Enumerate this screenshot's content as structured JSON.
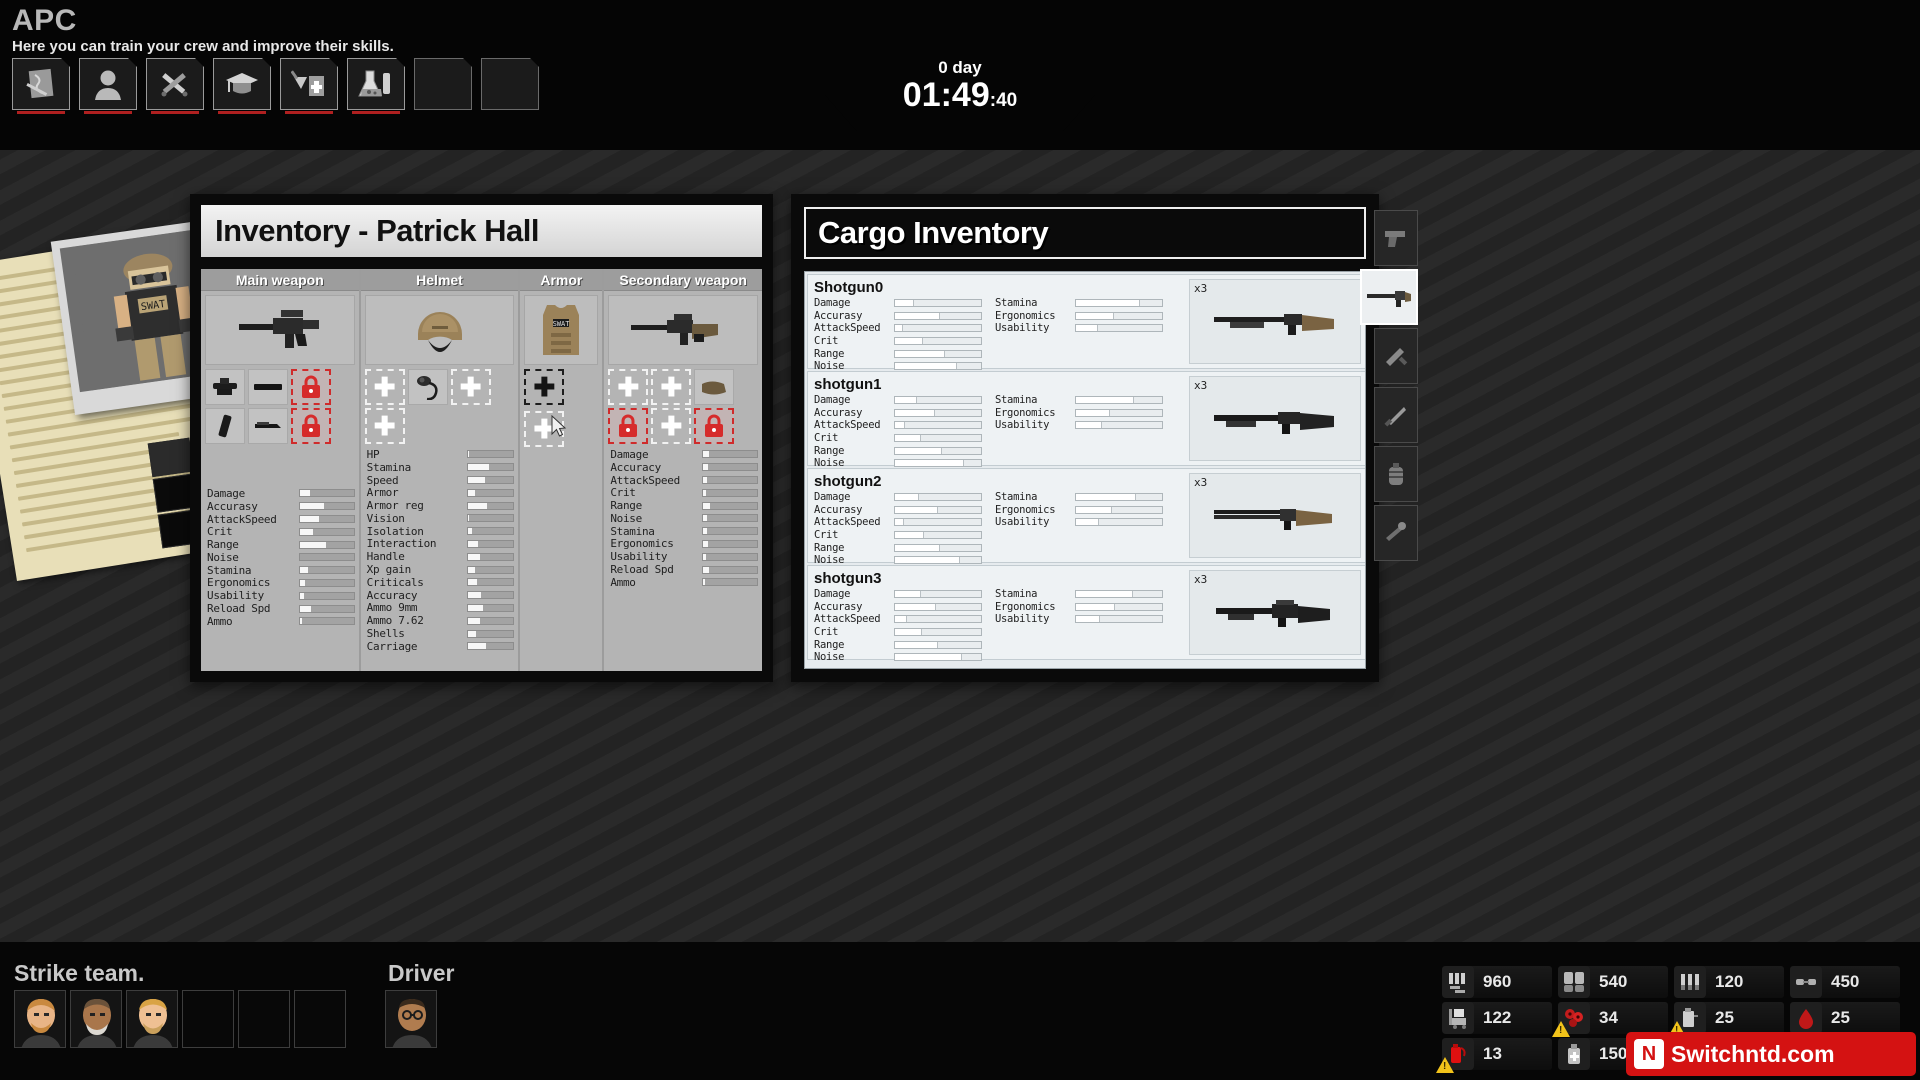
{
  "header": {
    "title": "APC",
    "subtitle": "Here you can train your crew and improve their skills.",
    "tabs": [
      {
        "name": "map-tab",
        "icon": "map-scroll-icon"
      },
      {
        "name": "crew-tab",
        "icon": "person-icon"
      },
      {
        "name": "workshop-tab",
        "icon": "hammer-wrench-icon"
      },
      {
        "name": "training-tab",
        "icon": "graduation-cap-icon"
      },
      {
        "name": "medical-tab",
        "icon": "medical-kit-icon"
      },
      {
        "name": "lab-tab",
        "icon": "flask-icon"
      },
      {
        "name": "empty-tab-1",
        "icon": "empty-icon"
      },
      {
        "name": "empty-tab-2",
        "icon": "empty-icon"
      }
    ]
  },
  "clock": {
    "day_label": "0 day",
    "time": "01:49",
    "seconds": ":40"
  },
  "inventory": {
    "title": "Inventory - Patrick Hall",
    "columns": [
      {
        "header": "Main weapon",
        "equipped_icon": "assault-rifle-icon",
        "mods": [
          {
            "type": "item",
            "icon": "scope-icon"
          },
          {
            "type": "item",
            "icon": "barrel-icon"
          },
          {
            "type": "locked",
            "icon": "lock-icon"
          },
          {
            "type": "item",
            "icon": "magazine-icon"
          },
          {
            "type": "item",
            "icon": "grip-icon"
          },
          {
            "type": "locked",
            "icon": "lock-icon"
          },
          {
            "type": "blank",
            "icon": ""
          }
        ],
        "stats": [
          {
            "label": "Damage",
            "value": 18
          },
          {
            "label": "Accurasy",
            "value": 44
          },
          {
            "label": "AttackSpeed",
            "value": 36
          },
          {
            "label": "Crit",
            "value": 24
          },
          {
            "label": "Range",
            "value": 48
          },
          {
            "label": "Noise",
            "value": 0
          },
          {
            "label": "Stamina",
            "value": 14
          },
          {
            "label": "Ergonomics",
            "value": 10
          },
          {
            "label": "Usability",
            "value": 8
          },
          {
            "label": "Reload Spd",
            "value": 20
          },
          {
            "label": "Ammo",
            "value": 3
          }
        ]
      },
      {
        "header": "Helmet",
        "equipped_icon": "combat-helmet-icon",
        "mods": [
          {
            "type": "empty",
            "icon": "plus-icon"
          },
          {
            "type": "item",
            "icon": "headset-icon"
          },
          {
            "type": "empty",
            "icon": "plus-icon"
          },
          {
            "type": "empty",
            "icon": "plus-icon"
          }
        ],
        "stats": [
          {
            "label": "HP",
            "value": 4
          },
          {
            "label": "Stamina",
            "value": 46
          },
          {
            "label": "Speed",
            "value": 38
          },
          {
            "label": "Armor",
            "value": 17
          },
          {
            "label": "Armor reg",
            "value": 43
          },
          {
            "label": "Vision",
            "value": 2
          },
          {
            "label": "Isolation",
            "value": 10
          },
          {
            "label": "Interaction",
            "value": 22
          },
          {
            "label": "Handle",
            "value": 28
          },
          {
            "label": "Xp gain",
            "value": 16
          },
          {
            "label": "Criticals",
            "value": 20
          },
          {
            "label": "Accuracy",
            "value": 30
          },
          {
            "label": "Ammo 9mm",
            "value": 34
          },
          {
            "label": "Ammo 7.62",
            "value": 26
          },
          {
            "label": "Shells",
            "value": 18
          },
          {
            "label": "Carriage",
            "value": 40
          }
        ]
      },
      {
        "header": "Armor",
        "equipped_icon": "body-armor-icon",
        "mods": [
          {
            "type": "empty-selected",
            "icon": "plus-icon"
          },
          {
            "type": "empty",
            "icon": "plus-icon"
          }
        ],
        "stats": []
      },
      {
        "header": "Secondary weapon",
        "equipped_icon": "carbine-icon",
        "mods": [
          {
            "type": "empty",
            "icon": "plus-icon"
          },
          {
            "type": "empty",
            "icon": "plus-icon"
          },
          {
            "type": "item",
            "icon": "stock-icon"
          },
          {
            "type": "locked",
            "icon": "lock-icon"
          },
          {
            "type": "empty",
            "icon": "plus-icon"
          },
          {
            "type": "locked",
            "icon": "lock-icon"
          }
        ],
        "stats": [
          {
            "label": "Damage",
            "value": 10
          },
          {
            "label": "Accuracy",
            "value": 8
          },
          {
            "label": "AttackSpeed",
            "value": 6
          },
          {
            "label": "Crit",
            "value": 5
          },
          {
            "label": "Range",
            "value": 12
          },
          {
            "label": "Noise",
            "value": 7
          },
          {
            "label": "Stamina",
            "value": 6
          },
          {
            "label": "Ergonomics",
            "value": 9
          },
          {
            "label": "Usability",
            "value": 5
          },
          {
            "label": "Reload Spd",
            "value": 11
          },
          {
            "label": "Ammo",
            "value": 4
          }
        ]
      }
    ]
  },
  "cargo": {
    "title": "Cargo Inventory",
    "items": [
      {
        "name": "Shotgun0",
        "quantity": "x3",
        "icon": "pump-shotgun-icon",
        "stats_left": [
          {
            "label": "Damage",
            "value": 22
          },
          {
            "label": "Accurasy",
            "value": 52
          },
          {
            "label": "AttackSpeed",
            "value": 9
          },
          {
            "label": "Crit",
            "value": 33
          },
          {
            "label": "Range",
            "value": 58
          },
          {
            "label": "Noise",
            "value": 72
          }
        ],
        "stats_right": [
          {
            "label": "Stamina",
            "value": 74
          },
          {
            "label": "Ergonomics",
            "value": 44
          },
          {
            "label": "Usability",
            "value": 25
          }
        ]
      },
      {
        "name": "shotgun1",
        "quantity": "x3",
        "icon": "combat-shotgun-icon",
        "stats_left": [
          {
            "label": "Damage",
            "value": 25
          },
          {
            "label": "Accurasy",
            "value": 47
          },
          {
            "label": "AttackSpeed",
            "value": 12
          },
          {
            "label": "Crit",
            "value": 30
          },
          {
            "label": "Range",
            "value": 55
          },
          {
            "label": "Noise",
            "value": 80
          }
        ],
        "stats_right": [
          {
            "label": "Stamina",
            "value": 68
          },
          {
            "label": "Ergonomics",
            "value": 40
          },
          {
            "label": "Usability",
            "value": 30
          }
        ]
      },
      {
        "name": "shotgun2",
        "quantity": "x3",
        "icon": "double-barrel-shotgun-icon",
        "stats_left": [
          {
            "label": "Damage",
            "value": 28
          },
          {
            "label": "Accurasy",
            "value": 50
          },
          {
            "label": "AttackSpeed",
            "value": 10
          },
          {
            "label": "Crit",
            "value": 34
          },
          {
            "label": "Range",
            "value": 52
          },
          {
            "label": "Noise",
            "value": 76
          }
        ],
        "stats_right": [
          {
            "label": "Stamina",
            "value": 70
          },
          {
            "label": "Ergonomics",
            "value": 42
          },
          {
            "label": "Usability",
            "value": 27
          }
        ]
      },
      {
        "name": "shotgun3",
        "quantity": "x3",
        "icon": "tactical-shotgun-icon",
        "stats_left": [
          {
            "label": "Damage",
            "value": 30
          },
          {
            "label": "Accurasy",
            "value": 48
          },
          {
            "label": "AttackSpeed",
            "value": 14
          },
          {
            "label": "Crit",
            "value": 31
          },
          {
            "label": "Range",
            "value": 50
          },
          {
            "label": "Noise",
            "value": 78
          }
        ],
        "stats_right": [
          {
            "label": "Stamina",
            "value": 66
          },
          {
            "label": "Ergonomics",
            "value": 45
          },
          {
            "label": "Usability",
            "value": 28
          }
        ]
      }
    ],
    "scroll_down": "▼"
  },
  "rail": {
    "slots": [
      {
        "name": "rail-slot-pistol",
        "icon": "pistol-icon",
        "selected": false
      },
      {
        "name": "rail-slot-rifle",
        "icon": "rifle-icon",
        "selected": true
      },
      {
        "name": "rail-slot-knife",
        "icon": "knife-icon",
        "selected": false
      },
      {
        "name": "rail-slot-blade",
        "icon": "blade-icon",
        "selected": false
      },
      {
        "name": "rail-slot-grenade",
        "icon": "grenade-icon",
        "selected": false
      },
      {
        "name": "rail-slot-tool",
        "icon": "tool-icon",
        "selected": false
      }
    ]
  },
  "bottom": {
    "strike_team_label": "Strike team.",
    "driver_label": "Driver",
    "strike_team": [
      {
        "name": "crew-member-1",
        "filled": true,
        "skin": "#e8b486",
        "hair": "#c9893f",
        "beard": true
      },
      {
        "name": "crew-member-2",
        "filled": true,
        "skin": "#a9764b",
        "hair": "#7a5c3c",
        "beard": true
      },
      {
        "name": "crew-member-3",
        "filled": true,
        "skin": "#efc093",
        "hair": "#d9a344",
        "beard": true
      },
      {
        "name": "crew-slot-empty-1",
        "filled": false
      },
      {
        "name": "crew-slot-empty-2",
        "filled": false
      },
      {
        "name": "crew-slot-empty-3",
        "filled": false
      }
    ],
    "driver": [
      {
        "name": "driver-member-1",
        "filled": true,
        "skin": "#b07c4f",
        "hair": "#3a2a1c",
        "beard": false
      }
    ],
    "resources": [
      {
        "name": "ammo-resource",
        "icon": "ammo-icon",
        "value": "960",
        "warning": false
      },
      {
        "name": "armor-resource",
        "icon": "armor-plates-icon",
        "value": "540",
        "warning": false
      },
      {
        "name": "shells-resource",
        "icon": "shells-icon",
        "value": "120",
        "warning": false
      },
      {
        "name": "parts-resource",
        "icon": "parts-icon",
        "value": "450",
        "warning": false
      },
      {
        "name": "cargo-resource",
        "icon": "cargo-cart-icon",
        "value": "122",
        "warning": false
      },
      {
        "name": "infection-resource",
        "icon": "infection-icon",
        "value": "34",
        "warning": true
      },
      {
        "name": "fuel-resource",
        "icon": "fuel-icon",
        "value": "25",
        "warning": true
      },
      {
        "name": "blood-resource",
        "icon": "blood-icon",
        "value": "25",
        "warning": false
      },
      {
        "name": "fire-resource",
        "icon": "fire-extinguisher-icon",
        "value": "13",
        "warning": true
      },
      {
        "name": "medicine-resource",
        "icon": "medicine-icon",
        "value": "150",
        "warning": false
      },
      {
        "name": "misc-resource",
        "icon": "misc-icon",
        "value": "",
        "warning": false
      }
    ]
  },
  "watermark": {
    "text": "Switchntd.com",
    "logo": "N",
    "color": "#d41212"
  }
}
